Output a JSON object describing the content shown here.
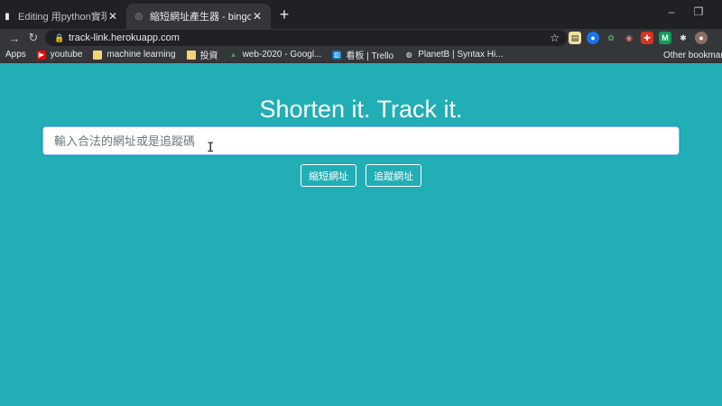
{
  "browser": {
    "tabs": [
      {
        "title": "Editing 用python實現縮短網址",
        "active": false
      },
      {
        "title": "縮短網址產生器 - bingcheng",
        "active": true
      }
    ],
    "new_tab_label": "+",
    "address": "track-link.herokuapp.com",
    "bookmarks": [
      {
        "label": "Apps",
        "icon": "apps-icon"
      },
      {
        "label": "youtube",
        "icon": "youtube-icon"
      },
      {
        "label": "machine learning",
        "icon": "folder-icon"
      },
      {
        "label": "投資",
        "icon": "folder-icon"
      },
      {
        "label": "web-2020 - Googl...",
        "icon": "google-drive-icon"
      },
      {
        "label": "看板 | Trello",
        "icon": "trello-icon"
      },
      {
        "label": "PlanetB | Syntax Hi...",
        "icon": "globe-icon"
      }
    ],
    "other_bookmarks": "Other bookmar"
  },
  "page": {
    "heading": "Shorten it. Track it.",
    "input_placeholder": "輸入合法的網址或是追蹤碼",
    "input_value": "",
    "shorten_button": "縮短網址",
    "track_button": "追蹤網址"
  },
  "colors": {
    "page_background": "#21aeb5",
    "browser_chrome": "#35363a"
  }
}
